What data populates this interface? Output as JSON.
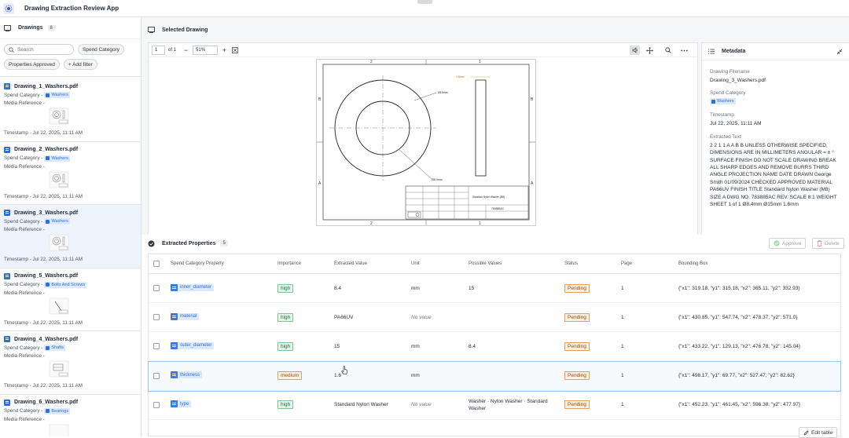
{
  "app": {
    "title": "Drawing Extraction Review App"
  },
  "sidebar": {
    "title": "Drawings",
    "count": "8",
    "search_placeholder": "Search",
    "filters": {
      "spend_category": "Spend Category",
      "properties_approved": "Properties Approved",
      "add_filter": "+ Add filter"
    },
    "items": [
      {
        "title": "Drawing_1_Washers.pdf",
        "spend_label": "Spend Category -",
        "spend_value": "Washers",
        "media_label": "Media Reference -",
        "timestamp": "Timestamp - Jul 22, 2025, 11:11 AM"
      },
      {
        "title": "Drawing_2_Washers.pdf",
        "spend_label": "Spend Category -",
        "spend_value": "Washers",
        "media_label": "Media Reference -",
        "timestamp": "Timestamp - Jul 22, 2025, 11:11 AM"
      },
      {
        "title": "Drawing_3_Washers.pdf",
        "spend_label": "Spend Category -",
        "spend_value": "Washers",
        "media_label": "Media Reference -",
        "timestamp": "Timestamp - Jul 22, 2025, 11:11 AM"
      },
      {
        "title": "Drawing_5_Washers.pdf",
        "spend_label": "Spend Category -",
        "spend_value": "Bolts And Screws",
        "media_label": "Media Reference -",
        "timestamp": "Timestamp - Jul 22, 2025, 11:11 AM"
      },
      {
        "title": "Drawing_4_Washers.pdf",
        "spend_label": "Spend Category -",
        "spend_value": "Shafts",
        "media_label": "Media Reference -",
        "timestamp": "Timestamp - Jul 22, 2025, 11:11 AM"
      },
      {
        "title": "Drawing_6_Washers.pdf",
        "spend_label": "Spend Category -",
        "spend_value": "Bearings",
        "media_label": "Media Reference -",
        "timestamp": ""
      }
    ]
  },
  "viewer": {
    "section_title": "Selected Drawing",
    "page": "1",
    "page_total": "of 1",
    "zoom": "51%",
    "drawing": {
      "grid_top_left": "2",
      "grid_top_right": "1",
      "grid_bottom_left": "2",
      "grid_bottom_right": "1",
      "grid_left_top": "B",
      "grid_left_bottom": "A",
      "grid_right_top": "B",
      "grid_right_bottom": "A",
      "dim_outer": "Ø15mm",
      "dim_inner": "Ø8.4mm",
      "dim_thickness": "1.6mm",
      "title_block_name": "Standard Nylon Washer (M8)",
      "title_block_number": "783885AC"
    }
  },
  "metadata": {
    "title": "Metadata",
    "filename_label": "Drawing Filename",
    "filename": "Drawing_3_Washers.pdf",
    "spend_label": "Spend Category",
    "spend_value": "Washers",
    "timestamp_label": "Timestamp",
    "timestamp": "Jul 22, 2025, 11:11 AM",
    "extracted_label": "Extracted Text",
    "extracted_text": "2 2 1 1 A A B B UNLESS OTHERWISE SPECIFIED, DIMENSIONS ARE IN MILLIMETERS ANGULAR = ± ° SURFACE FINISH DO NOT SCALE DRAWING BREAK ALL SHARP EDGES AND REMOVE BURRS THIRD ANGLE PROJECTION NAME DATE DRAWN George Smith 01/09/2024 CHECKED APPROVED MATERIAL PA66UV FINISH TITLE Standard Nylon Washer (M8) SIZE A DWG NO. 783885AC REV. SCALE 8:1 WEIGHT SHEET 1 of 1 Ø8.4mm Ø15mm 1.6mm"
  },
  "properties": {
    "title": "Extracted Properties",
    "count": "5",
    "approve_label": "Approve",
    "delete_label": "Delete",
    "edit_table_label": "Edit table",
    "columns": [
      "Spend Category Property",
      "Importance",
      "Extracted Value",
      "Unit",
      "Possible Values",
      "Status",
      "Page",
      "Bounding Box"
    ],
    "rows": [
      {
        "property": "inner_diameter",
        "importance": "high",
        "value": "8.4",
        "unit": "mm",
        "possible": "15",
        "status": "Pending",
        "page": "1",
        "bbox": "{\"x1\": 319.18, \"y1\": 315.18, \"x2\": 365.11, \"y2\": 332.93}"
      },
      {
        "property": "material",
        "importance": "high",
        "value": "PA66UV",
        "unit": "No value",
        "possible": "",
        "status": "Pending",
        "page": "1",
        "bbox": "{\"x1\": 430.85, \"y1\": 547.74, \"x2\": 478.37, \"y2\": 571.0}"
      },
      {
        "property": "outer_diameter",
        "importance": "high",
        "value": "15",
        "unit": "mm",
        "possible": "8.4",
        "status": "Pending",
        "page": "1",
        "bbox": "{\"x1\": 433.22, \"y1\": 129.13, \"x2\": 476.78, \"y2\": 145.04}"
      },
      {
        "property": "thickness",
        "importance": "medium",
        "value": "1.6",
        "unit": "mm",
        "possible": "",
        "status": "Pending",
        "page": "1",
        "bbox": "{\"x1\": 498.17, \"y1\": 69.77, \"x2\": 527.47, \"y2\": 82.62}"
      },
      {
        "property": "type",
        "importance": "high",
        "value": "Standard Nylon Washer",
        "unit": "No value",
        "possible": "Washer · Nylon Washer · Standard Washer",
        "status": "Pending",
        "page": "1",
        "bbox": "{\"x1\": 452.23, \"y1\": 461.45, \"x2\": 596.38, \"y2\": 477.97}"
      }
    ]
  }
}
